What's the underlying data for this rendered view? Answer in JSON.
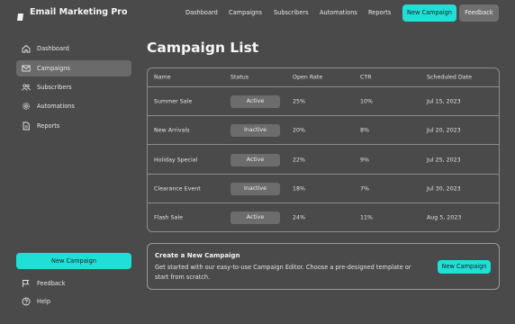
{
  "app": {
    "title": "Email Marketing Pro"
  },
  "topnav": {
    "links": [
      "Dashboard",
      "Campaigns",
      "Subscribers",
      "Automations",
      "Reports"
    ],
    "new_campaign_label": "New Campaign",
    "feedback_label": "Feedback"
  },
  "sidebar": {
    "items": [
      {
        "label": "Dashboard",
        "icon": "home-icon",
        "active": false
      },
      {
        "label": "Campaigns",
        "icon": "mail-icon",
        "active": true
      },
      {
        "label": "Subscribers",
        "icon": "users-icon",
        "active": false
      },
      {
        "label": "Automations",
        "icon": "gear-icon",
        "active": false
      },
      {
        "label": "Reports",
        "icon": "document-icon",
        "active": false
      }
    ],
    "new_campaign_label": "New Campaign",
    "feedback_label": "Feedback",
    "help_label": "Help"
  },
  "main": {
    "title": "Campaign List",
    "table": {
      "headers": [
        "Name",
        "Status",
        "Open Rate",
        "CTR",
        "Scheduled Date"
      ],
      "rows": [
        {
          "name": "Summer Sale",
          "status": "Active",
          "open_rate": "25%",
          "ctr": "10%",
          "date": "Jul 15, 2023"
        },
        {
          "name": "New Arrivals",
          "status": "Inactive",
          "open_rate": "20%",
          "ctr": "8%",
          "date": "Jul 20, 2023"
        },
        {
          "name": "Holiday Special",
          "status": "Active",
          "open_rate": "22%",
          "ctr": "9%",
          "date": "Jul 25, 2023"
        },
        {
          "name": "Clearance Event",
          "status": "Inactive",
          "open_rate": "18%",
          "ctr": "7%",
          "date": "Jul 30, 2023"
        },
        {
          "name": "Flash Sale",
          "status": "Active",
          "open_rate": "24%",
          "ctr": "11%",
          "date": "Aug 5, 2023"
        }
      ]
    },
    "cta": {
      "title": "Create a New Campaign",
      "description": "Get started with our easy-to-use Campaign Editor. Choose a pre-designed template or start from scratch.",
      "button_label": "New Campaign"
    }
  },
  "colors": {
    "background": "#4a4a4a",
    "accent": "#1fe0d6",
    "active_item": "#6a6a6a",
    "pill": "#6c6c6c"
  }
}
